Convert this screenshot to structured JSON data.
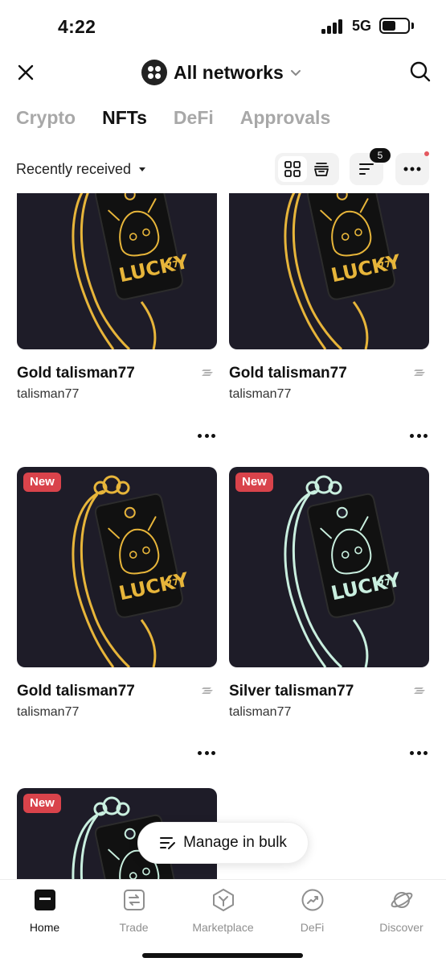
{
  "status_bar": {
    "time": "4:22",
    "network": "5G"
  },
  "top_bar": {
    "network_selector": "All networks"
  },
  "tabs": [
    {
      "label": "Crypto",
      "active": false
    },
    {
      "label": "NFTs",
      "active": true
    },
    {
      "label": "DeFi",
      "active": false
    },
    {
      "label": "Approvals",
      "active": false
    }
  ],
  "filter": {
    "sort_label": "Recently received",
    "filter_count": "5"
  },
  "nfts": [
    {
      "title": "Gold talisman77",
      "collection": "talisman77",
      "variant": "gold",
      "is_new": false,
      "badge": ""
    },
    {
      "title": "Gold talisman77",
      "collection": "talisman77",
      "variant": "gold",
      "is_new": false,
      "badge": ""
    },
    {
      "title": "Gold talisman77",
      "collection": "talisman77",
      "variant": "gold",
      "is_new": true,
      "badge": "New"
    },
    {
      "title": "Silver talisman77",
      "collection": "talisman77",
      "variant": "silver",
      "is_new": true,
      "badge": "New"
    },
    {
      "title": "",
      "collection": "",
      "variant": "silver",
      "is_new": true,
      "badge": "New"
    }
  ],
  "artwork_text": {
    "line1": "LUCKY",
    "line2": "77"
  },
  "bulk_action": {
    "label": "Manage in bulk"
  },
  "bottom_nav": [
    {
      "label": "Home",
      "icon": "home-icon",
      "active": true
    },
    {
      "label": "Trade",
      "icon": "trade-icon",
      "active": false
    },
    {
      "label": "Marketplace",
      "icon": "marketplace-icon",
      "active": false
    },
    {
      "label": "DeFi",
      "icon": "defi-icon",
      "active": false
    },
    {
      "label": "Discover",
      "icon": "discover-icon",
      "active": false
    }
  ],
  "colors": {
    "gold": "#e7b53a",
    "silver": "#c9efdf",
    "card_bg": "#1e1c28",
    "badge_red": "#d9434b",
    "accent_dot": "#e4585f"
  }
}
